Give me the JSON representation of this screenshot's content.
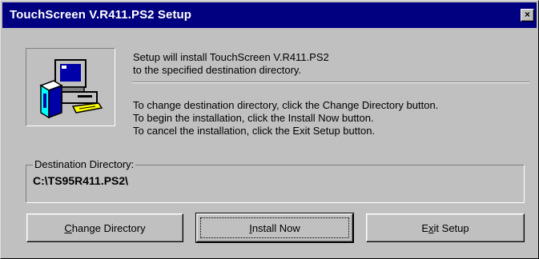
{
  "window": {
    "title": "TouchScreen V.R411.PS2 Setup",
    "close_glyph": "×"
  },
  "messages": {
    "intro_line1": "Setup will install TouchScreen V.R411.PS2",
    "intro_line2": "to the specified destination directory.",
    "instr_line1": "To change destination directory, click the Change Directory button.",
    "instr_line2": "To begin the installation, click the Install Now button.",
    "instr_line3": "To cancel the installation, click the Exit Setup button."
  },
  "destination": {
    "label": "Destination Directory:",
    "path": "C:\\TS95R411.PS2\\"
  },
  "buttons": {
    "change_directory": {
      "accel": "C",
      "rest": "hange Directory"
    },
    "install_now": {
      "accel": "I",
      "rest": "nstall Now"
    },
    "exit_setup": {
      "pre": "E",
      "accel": "x",
      "rest": "it Setup"
    }
  },
  "icons": {
    "setup": "computer-setup-icon",
    "close": "close-icon"
  },
  "colors": {
    "titlebar": "#000080",
    "face": "#c0c0c0"
  }
}
